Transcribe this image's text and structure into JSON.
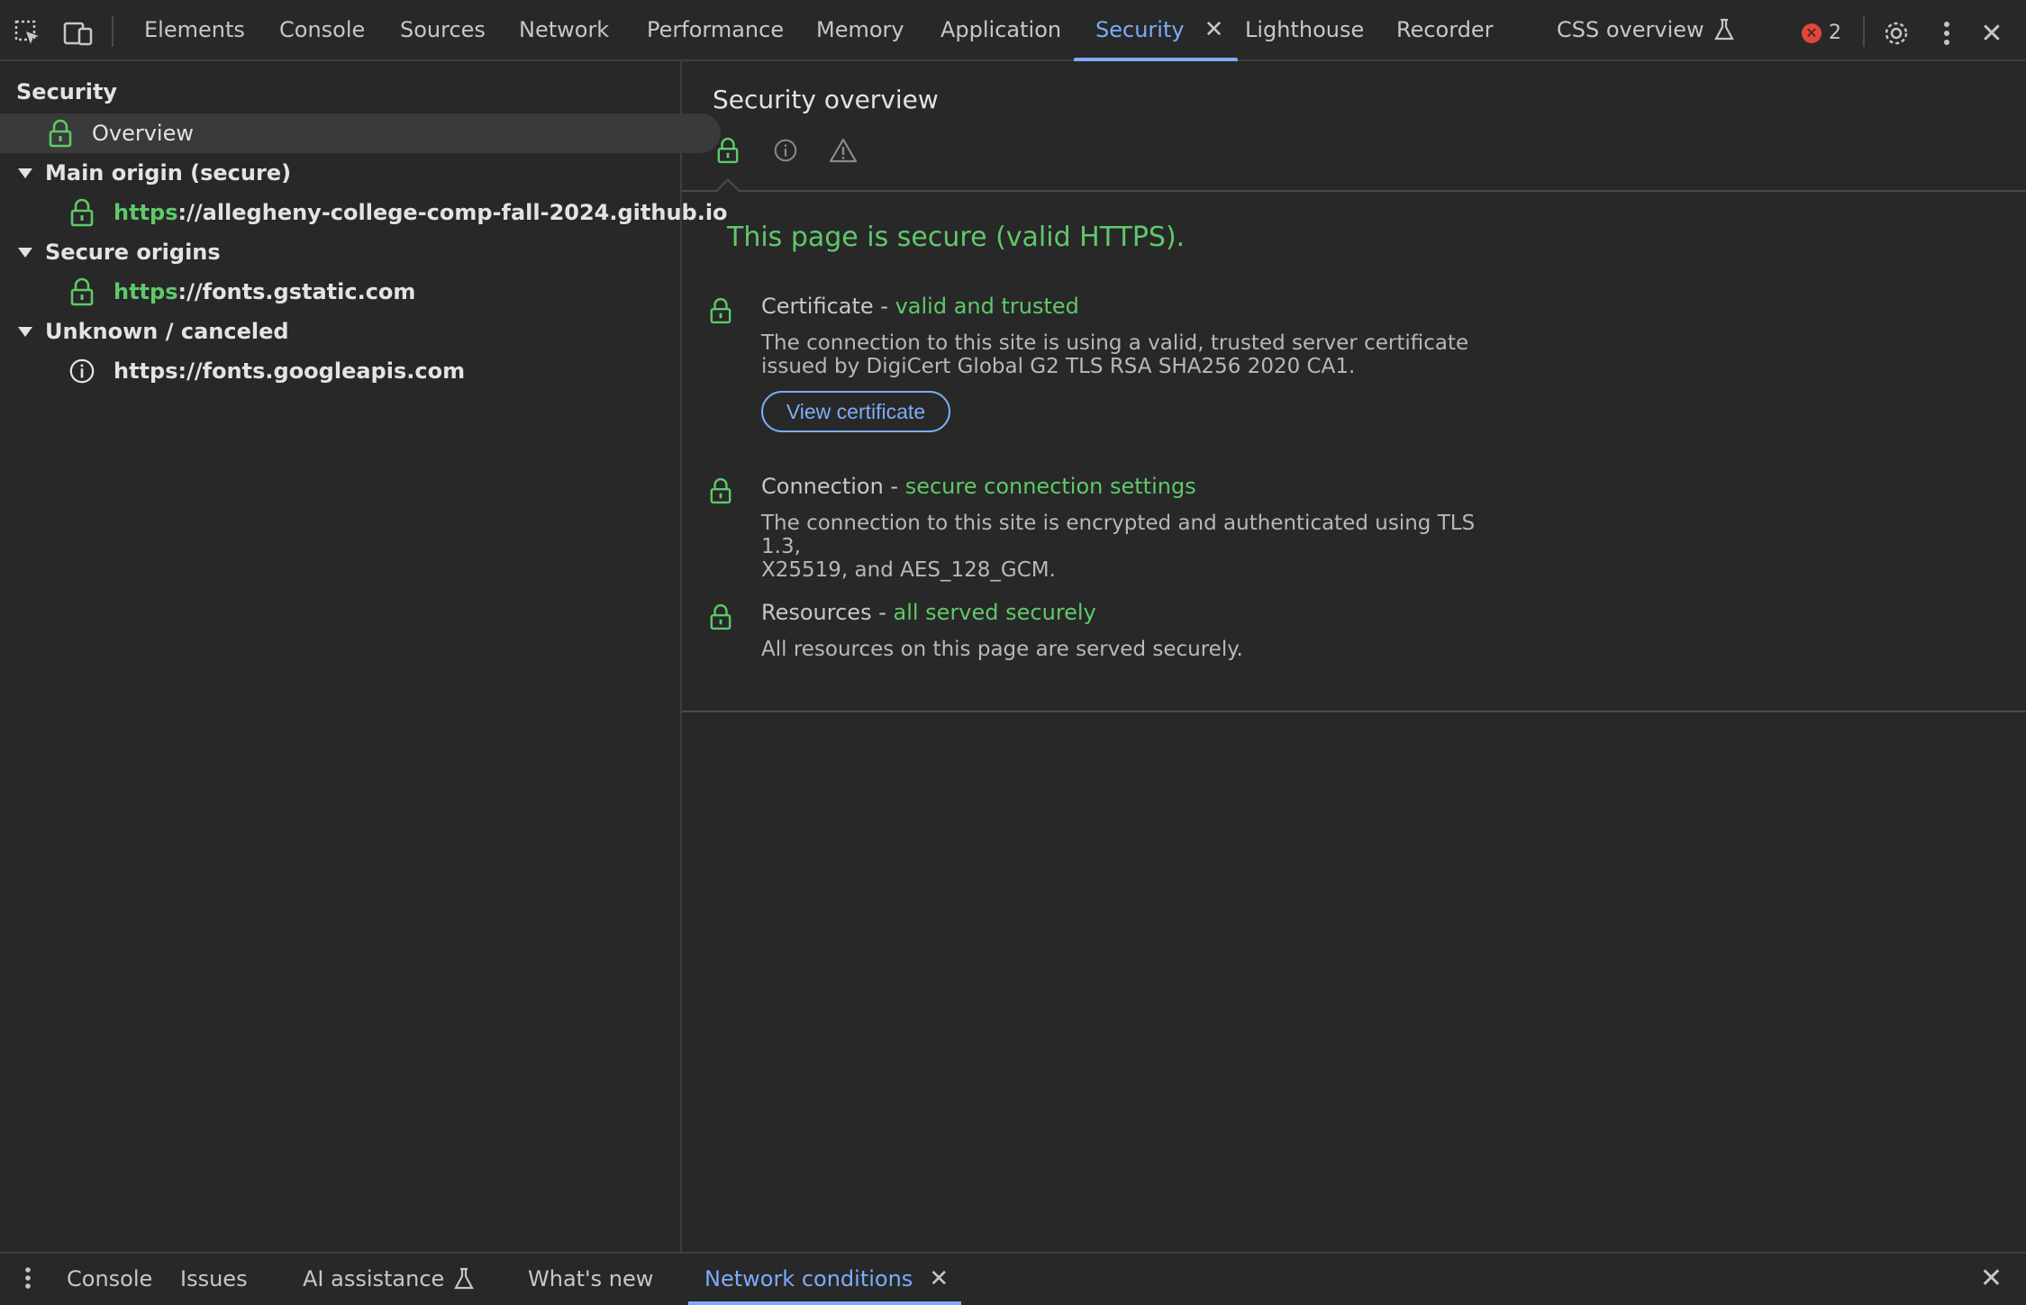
{
  "topbar": {
    "tabs": [
      {
        "label": "Elements"
      },
      {
        "label": "Console"
      },
      {
        "label": "Sources"
      },
      {
        "label": "Network"
      },
      {
        "label": "Performance"
      },
      {
        "label": "Memory"
      },
      {
        "label": "Application"
      },
      {
        "label": "Security",
        "active": true,
        "closable": true
      },
      {
        "label": "Lighthouse"
      },
      {
        "label": "Recorder"
      },
      {
        "label": "CSS overview",
        "experimental": true
      }
    ],
    "error_count": "2",
    "icons": [
      "inspect-element-icon",
      "device-toolbar-icon",
      "gear-icon",
      "more-vert-icon",
      "close-icon"
    ]
  },
  "sidebar": {
    "title": "Security",
    "overview_label": "Overview",
    "groups": [
      {
        "label": "Main origin (secure)",
        "origin_scheme": "https",
        "origin_rest": "://allegheny-college-comp-fall-2024.github.io",
        "icon": "lock-icon"
      },
      {
        "label": "Secure origins",
        "origin_scheme": "https",
        "origin_rest": "://fonts.gstatic.com",
        "icon": "lock-icon"
      },
      {
        "label": "Unknown / canceled",
        "origin": "https://fonts.googleapis.com",
        "icon": "info-icon"
      }
    ]
  },
  "main": {
    "title": "Security overview",
    "summary": "This page is secure (valid HTTPS).",
    "explanations": [
      {
        "title": "Certificate",
        "sep": " - ",
        "status": "valid and trusted",
        "desc_line1": "The connection to this site is using a valid, trusted server certificate",
        "desc_line2": "issued by DigiCert Global G2 TLS RSA SHA256 2020 CA1.",
        "button": "View certificate"
      },
      {
        "title": "Connection",
        "sep": " - ",
        "status": "secure connection settings",
        "desc_line1": "The connection to this site is encrypted and authenticated using TLS 1.3,",
        "desc_line2": "X25519, and AES_128_GCM."
      },
      {
        "title": "Resources",
        "sep": " - ",
        "status": "all served securely",
        "desc_line1": "All resources on this page are served securely."
      }
    ]
  },
  "drawer": {
    "tabs": [
      {
        "label": "Console"
      },
      {
        "label": "Issues"
      },
      {
        "label": "AI assistance",
        "experimental": true
      },
      {
        "label": "What's new"
      },
      {
        "label": "Network conditions",
        "active": true,
        "closable": true
      }
    ]
  },
  "colors": {
    "background": "#282828",
    "accent": "#7cacf8",
    "secure_green": "#5ec96a",
    "error_red": "#e2453b"
  }
}
